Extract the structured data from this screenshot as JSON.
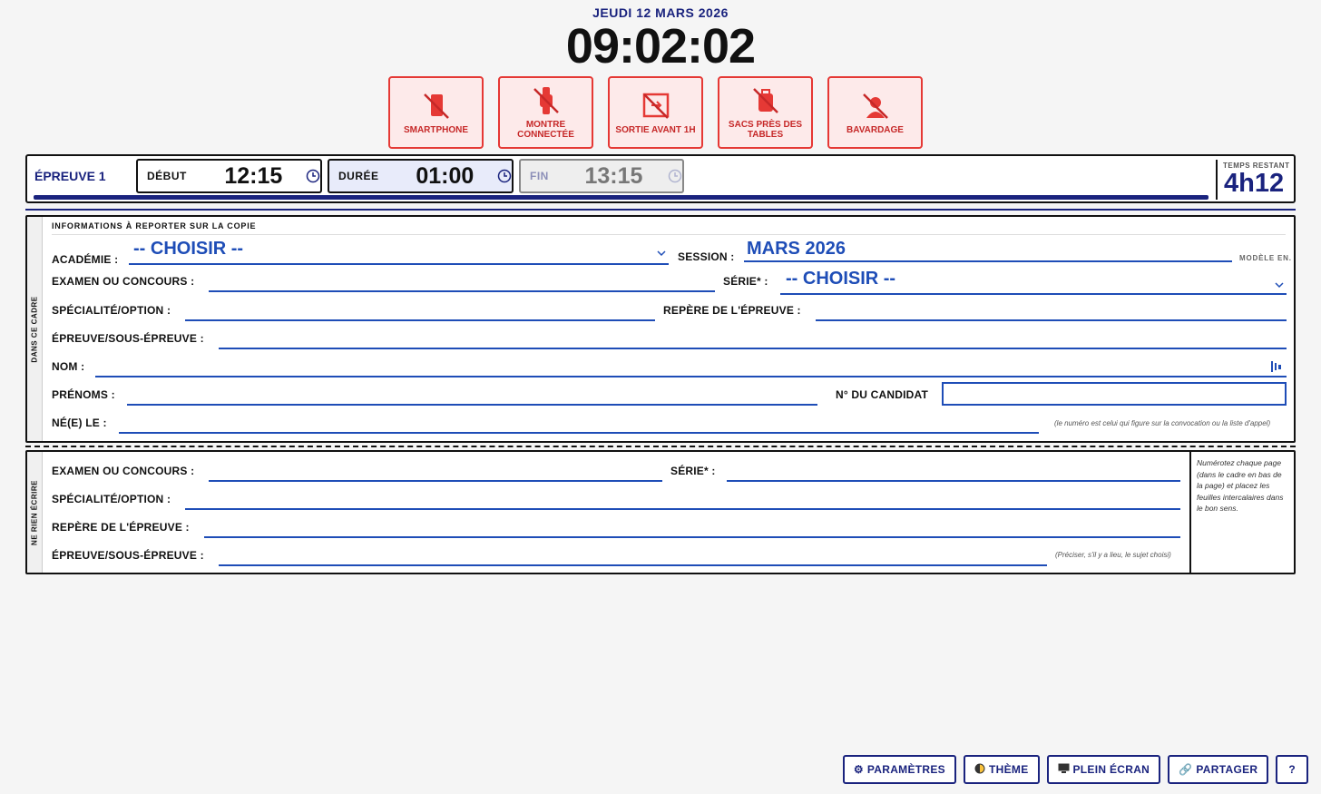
{
  "header": {
    "date": "JEUDI 12 MARS 2026",
    "clock": "09:02:02"
  },
  "rules": [
    {
      "label": "SMARTPHONE",
      "icon": "no-smartphone-icon"
    },
    {
      "label": "MONTRE CONNECTÉE",
      "icon": "no-smartwatch-icon"
    },
    {
      "label": "SORTIE AVANT 1H",
      "icon": "no-exit-icon"
    },
    {
      "label": "SACS PRÈS DES TABLES",
      "icon": "no-bag-icon"
    },
    {
      "label": "BAVARDAGE",
      "icon": "no-talking-icon"
    }
  ],
  "timer": {
    "epreuve": "ÉPREUVE 1",
    "debut_label": "DÉBUT",
    "debut": "12:15",
    "duree_label": "DURÉE",
    "duree": "01:00",
    "fin_label": "FIN",
    "fin": "13:15",
    "remaining_label": "TEMPS RESTANT",
    "remaining": "4h12",
    "progress_fraction": 0.93
  },
  "form": {
    "side_label": "DANS CE CADRE",
    "heading": "INFORMATIONS À REPORTER SUR LA COPIE",
    "academie_label": "ACADÉMIE :",
    "academie_value": "-- CHOISIR --",
    "session_label": "SESSION :",
    "session_value": "MARS 2026",
    "modele": "MODÈLE EN.",
    "examen_label": "EXAMEN OU CONCOURS :",
    "serie_label": "SÉRIE* :",
    "serie_value": "-- CHOISIR --",
    "specialite_label": "SPÉCIALITÉ/OPTION :",
    "repere_label": "REPÈRE DE L'ÉPREUVE :",
    "epreuve_label": "ÉPREUVE/SOUS-ÉPREUVE :",
    "nom_label": "NOM :",
    "prenoms_label": "PRÉNOMS :",
    "candidat_label": "N° DU CANDIDAT",
    "nele_label": "NÉ(E) LE :",
    "candidat_note": "(le numéro est celui qui figure sur la convocation ou la liste d'appel)"
  },
  "form2": {
    "side_label": "NE RIEN ÉCRIRE",
    "examen_label": "EXAMEN OU CONCOURS :",
    "serie_label": "SÉRIE* :",
    "specialite_label": "SPÉCIALITÉ/OPTION :",
    "repere_label": "REPÈRE DE L'ÉPREUVE :",
    "epreuve_label": "ÉPREUVE/SOUS-ÉPREUVE :",
    "preciser_note": "(Préciser, s'il y a lieu, le sujet choisi)",
    "instructions": "Numérotez chaque page (dans le cadre en bas de la page) et placez les feuilles intercalaires dans le bon sens."
  },
  "footer": {
    "parametres": "PARAMÈTRES",
    "theme": "THÈME",
    "plein_ecran": "PLEIN ÉCRAN",
    "partager": "PARTAGER",
    "help": "?"
  },
  "colors": {
    "accent": "#1a237e",
    "field_blue": "#1e4db7",
    "rule_red": "#e53935"
  }
}
